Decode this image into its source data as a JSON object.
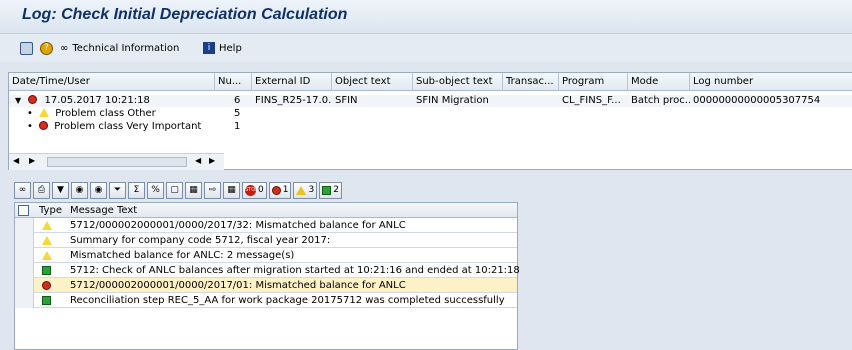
{
  "window": {
    "title": "Log: Check Initial Depreciation Calculation"
  },
  "toolbar": {
    "technical_info": "Technical Information",
    "help": "Help"
  },
  "log_table": {
    "columns": [
      "Date/Time/User",
      "Nu...",
      "External ID",
      "Object text",
      "Sub-object text",
      "Transac...",
      "Program",
      "Mode",
      "Log number"
    ],
    "rows": [
      {
        "date": "17.05.2017  10:21:18",
        "num": "6",
        "external_id": "FINS_R25-17.0...",
        "object_text": "SFIN",
        "sub_object_text": "SFIN Migration",
        "transaction": "",
        "program": "CL_FINS_F...",
        "mode": "Batch proc...",
        "log_number": "00000000000005307754"
      },
      {
        "label": "Problem class Other",
        "num": "5"
      },
      {
        "label": "Problem class Very Important",
        "num": "1"
      }
    ]
  },
  "msg_toolbar": {
    "stop_count": "0",
    "error_count": "1",
    "warning_count": "3",
    "info_count": "2"
  },
  "messages": {
    "header": {
      "type": "Type",
      "text": "Message Text"
    },
    "rows": [
      {
        "type": "warning",
        "text": "5712/000002000001/0000/2017/32: Mismatched balance for ANLC"
      },
      {
        "type": "warning",
        "text": "Summary for company code 5712, fiscal year 2017:"
      },
      {
        "type": "warning",
        "text": "Mismatched balance for ANLC: 2 message(s)"
      },
      {
        "type": "success",
        "text": "5712: Check of ANLC balances after migration started at 10:21:16 and ended at 10:21:18"
      },
      {
        "type": "error",
        "text": "5712/000002000001/0000/2017/01: Mismatched balance for ANLC"
      },
      {
        "type": "success",
        "text": "Reconciliation step REC_5_AA for work package 20175712 was completed successfully"
      }
    ]
  },
  "colors": {
    "warning": "#f6d83a",
    "error": "#d52d1c",
    "success": "#2aa13a",
    "highlight": "#fdf1c7"
  }
}
